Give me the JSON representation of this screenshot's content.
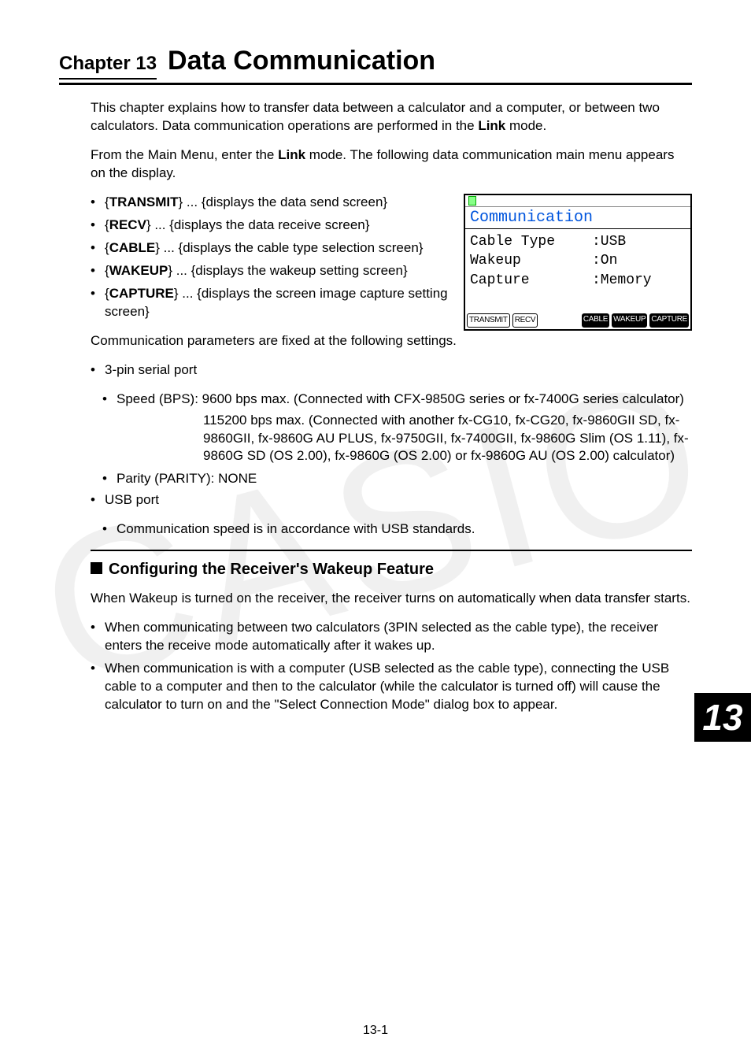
{
  "chapter": {
    "label": "Chapter 13",
    "title": "Data Communication"
  },
  "intro1a": "This chapter explains how to transfer data between a calculator and a computer, or between two calculators. Data communication operations are performed in the ",
  "intro1_bold": "Link",
  "intro1b": " mode.",
  "intro2a": "From the Main Menu, enter the ",
  "intro2_bold": "Link",
  "intro2b": " mode. The following data communication main menu appears on the display.",
  "menu": {
    "transmit": {
      "name": "TRANSMIT",
      "desc": " ... {displays the data send screen}"
    },
    "recv": {
      "name": "RECV",
      "desc": " ... {displays the data receive screen}"
    },
    "cable": {
      "name": "CABLE",
      "desc": " ... {displays the cable type selection screen}"
    },
    "wakeup": {
      "name": "WAKEUP",
      "desc": " ... {displays the wakeup setting screen}"
    },
    "capture": {
      "name": "CAPTURE",
      "desc": " ... {displays the screen image capture setting screen}"
    }
  },
  "calc": {
    "title": "Communication",
    "rows": [
      {
        "l": "Cable Type",
        "r": ":USB"
      },
      {
        "l": "Wakeup",
        "r": ":On"
      },
      {
        "l": "Capture",
        "r": ":Memory"
      }
    ],
    "softkeys": [
      "TRANSMIT",
      "RECV",
      "CABLE",
      "WAKEUP",
      "CAPTURE"
    ]
  },
  "fixed_intro": "Communication parameters are fixed at the following settings.",
  "serial_label": "3-pin serial port",
  "speed1": "Speed (BPS): 9600 bps max. (Connected with CFX-9850G series or fx-7400G series calculator)",
  "speed2": "115200 bps max. (Connected with another fx-CG10, fx-CG20, fx-9860GII SD, fx-9860GII, fx-9860G AU PLUS, fx-9750GII, fx-7400GII, fx-9860G Slim (OS 1.11), fx-9860G SD (OS 2.00), fx-9860G (OS 2.00) or fx-9860G AU (OS 2.00) calculator)",
  "parity": "Parity (PARITY): NONE",
  "usb_label": "USB port",
  "usb_note": "Communication speed is in accordance with USB standards.",
  "section_title": "Configuring the Receiver's Wakeup Feature",
  "wake_intro": "When Wakeup is turned on the receiver, the receiver turns on automatically when data transfer starts.",
  "wake_b1": "When communicating between two calculators (3PIN selected as the cable type), the receiver enters the receive mode automatically after it wakes up.",
  "wake_b2": "When communication is with a computer (USB selected as the cable type), connecting the USB cable to a computer and then to the calculator (while the calculator is turned off) will cause the calculator to turn on and the \"Select Connection Mode\" dialog box to appear.",
  "pagenum": "13-1",
  "sidenum": "13",
  "watermark": "CASIO"
}
